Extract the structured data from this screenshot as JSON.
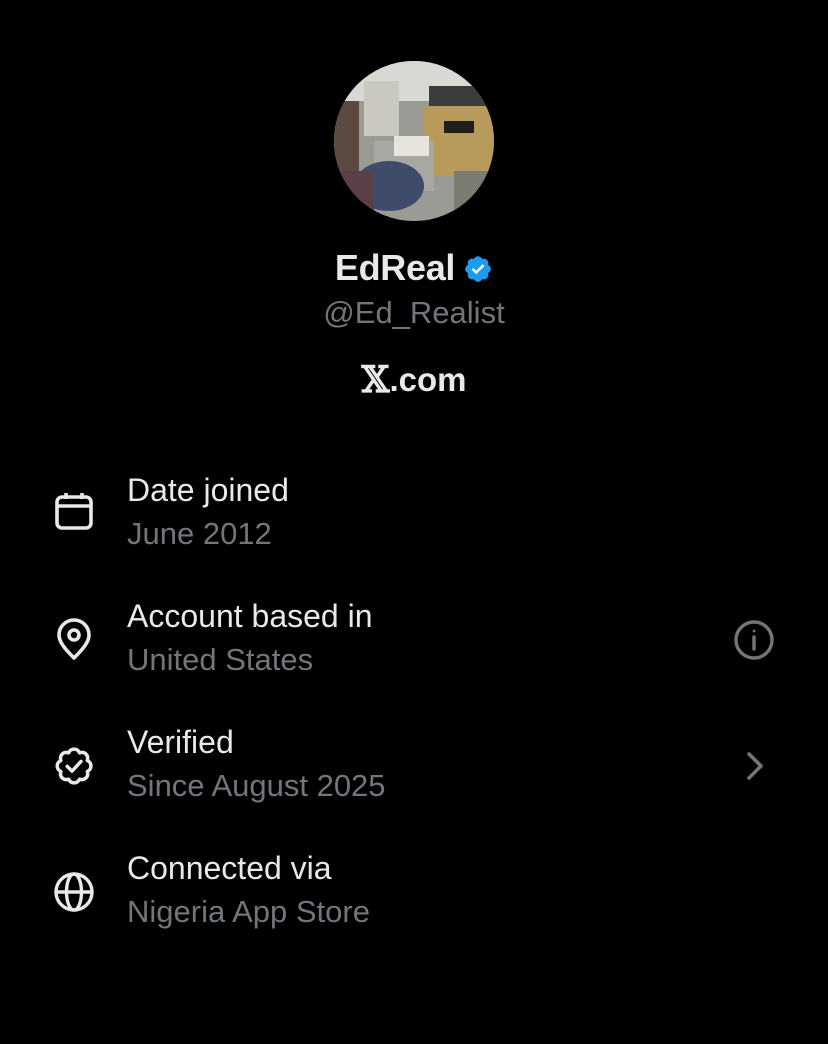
{
  "profile": {
    "display_name": "EdReal",
    "handle": "@Ed_Realist",
    "verified_color": "#1d9bf0",
    "avatar_icon": "office-photo-avatar"
  },
  "site": {
    "logo": "𝕏",
    "domain": ".com"
  },
  "details": [
    {
      "icon": "calendar-icon",
      "label": "Date joined",
      "value": "June 2012"
    },
    {
      "icon": "location-pin-icon",
      "label": "Account based in",
      "value": "United States",
      "action_icon": "info-icon"
    },
    {
      "icon": "verified-check-icon",
      "label": "Verified",
      "value": "Since August 2025",
      "action_icon": "chevron-right-icon"
    },
    {
      "icon": "globe-icon",
      "label": "Connected via",
      "value": "Nigeria App Store"
    }
  ],
  "colors": {
    "background": "#000000",
    "primary_text": "#e7e9ea",
    "secondary_text": "#71767b"
  }
}
